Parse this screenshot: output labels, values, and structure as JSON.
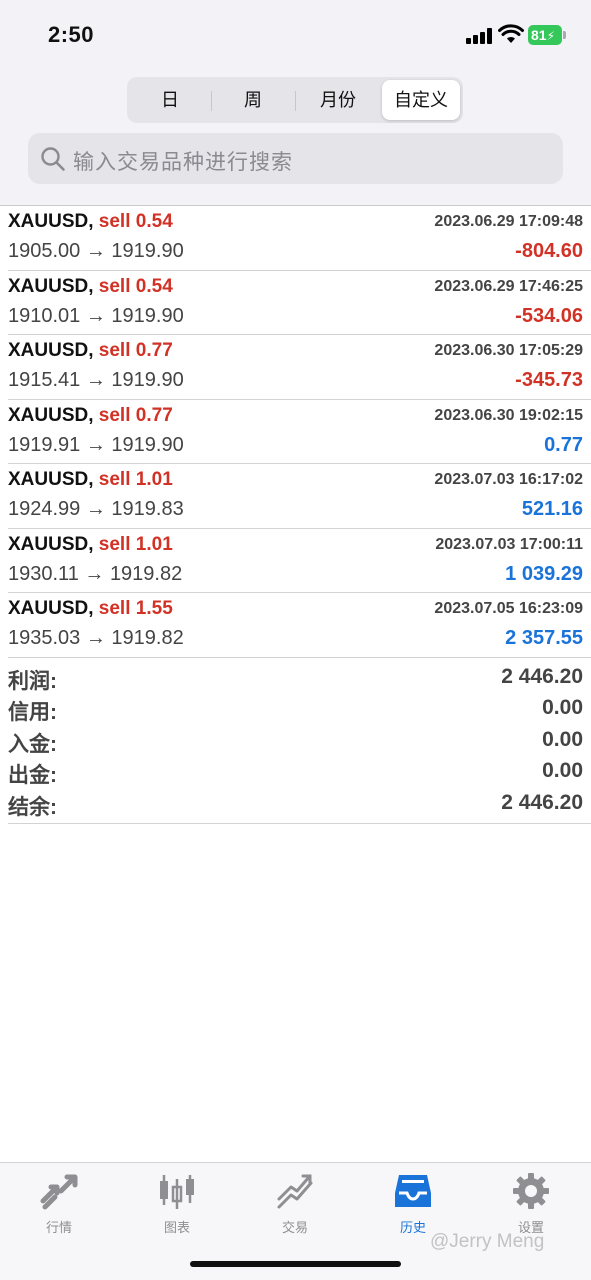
{
  "status_bar": {
    "time": "2:50",
    "battery": "81"
  },
  "period_tabs": [
    {
      "label": "日"
    },
    {
      "label": "周"
    },
    {
      "label": "月份"
    },
    {
      "label": "自定义",
      "active": true
    }
  ],
  "search": {
    "placeholder": "输入交易品种进行搜索"
  },
  "trades": [
    {
      "symbol": "XAUUSD,",
      "side": "sell",
      "volume": "0.54",
      "time": "2023.06.29 17:09:48",
      "open_price": "1905.00",
      "arrow": "→",
      "close_price": "1919.90",
      "profit": "-804.60",
      "profit_sign": "neg"
    },
    {
      "symbol": "XAUUSD,",
      "side": "sell",
      "volume": "0.54",
      "time": "2023.06.29 17:46:25",
      "open_price": "1910.01",
      "arrow": "→",
      "close_price": "1919.90",
      "profit": "-534.06",
      "profit_sign": "neg"
    },
    {
      "symbol": "XAUUSD,",
      "side": "sell",
      "volume": "0.77",
      "time": "2023.06.30 17:05:29",
      "open_price": "1915.41",
      "arrow": "→",
      "close_price": "1919.90",
      "profit": "-345.73",
      "profit_sign": "neg"
    },
    {
      "symbol": "XAUUSD,",
      "side": "sell",
      "volume": "0.77",
      "time": "2023.06.30 19:02:15",
      "open_price": "1919.91",
      "arrow": "→",
      "close_price": "1919.90",
      "profit": "0.77",
      "profit_sign": "pos"
    },
    {
      "symbol": "XAUUSD,",
      "side": "sell",
      "volume": "1.01",
      "time": "2023.07.03 16:17:02",
      "open_price": "1924.99",
      "arrow": "→",
      "close_price": "1919.83",
      "profit": "521.16",
      "profit_sign": "pos"
    },
    {
      "symbol": "XAUUSD,",
      "side": "sell",
      "volume": "1.01",
      "time": "2023.07.03 17:00:11",
      "open_price": "1930.11",
      "arrow": "→",
      "close_price": "1919.82",
      "profit": "1 039.29",
      "profit_sign": "pos"
    },
    {
      "symbol": "XAUUSD,",
      "side": "sell",
      "volume": "1.55",
      "time": "2023.07.05 16:23:09",
      "open_price": "1935.03",
      "arrow": "→",
      "close_price": "1919.82",
      "profit": "2 357.55",
      "profit_sign": "pos"
    }
  ],
  "summary": [
    {
      "label": "利润:",
      "value": "2 446.20"
    },
    {
      "label": "信用:",
      "value": "0.00"
    },
    {
      "label": "入金:",
      "value": "0.00"
    },
    {
      "label": "出金:",
      "value": "0.00"
    },
    {
      "label": "结余:",
      "value": "2 446.20"
    }
  ],
  "tab_bar": [
    {
      "label": "行情",
      "icon": "quotes-icon"
    },
    {
      "label": "图表",
      "icon": "chart-icon"
    },
    {
      "label": "交易",
      "icon": "trade-icon"
    },
    {
      "label": "历史",
      "icon": "history-icon",
      "active": true
    },
    {
      "label": "设置",
      "icon": "gear-icon"
    }
  ],
  "watermark": "@Jerry Meng",
  "colors": {
    "negative": "#d23226",
    "positive": "#1a73d9",
    "active_tab": "#1a73d9",
    "battery": "#34c759"
  }
}
